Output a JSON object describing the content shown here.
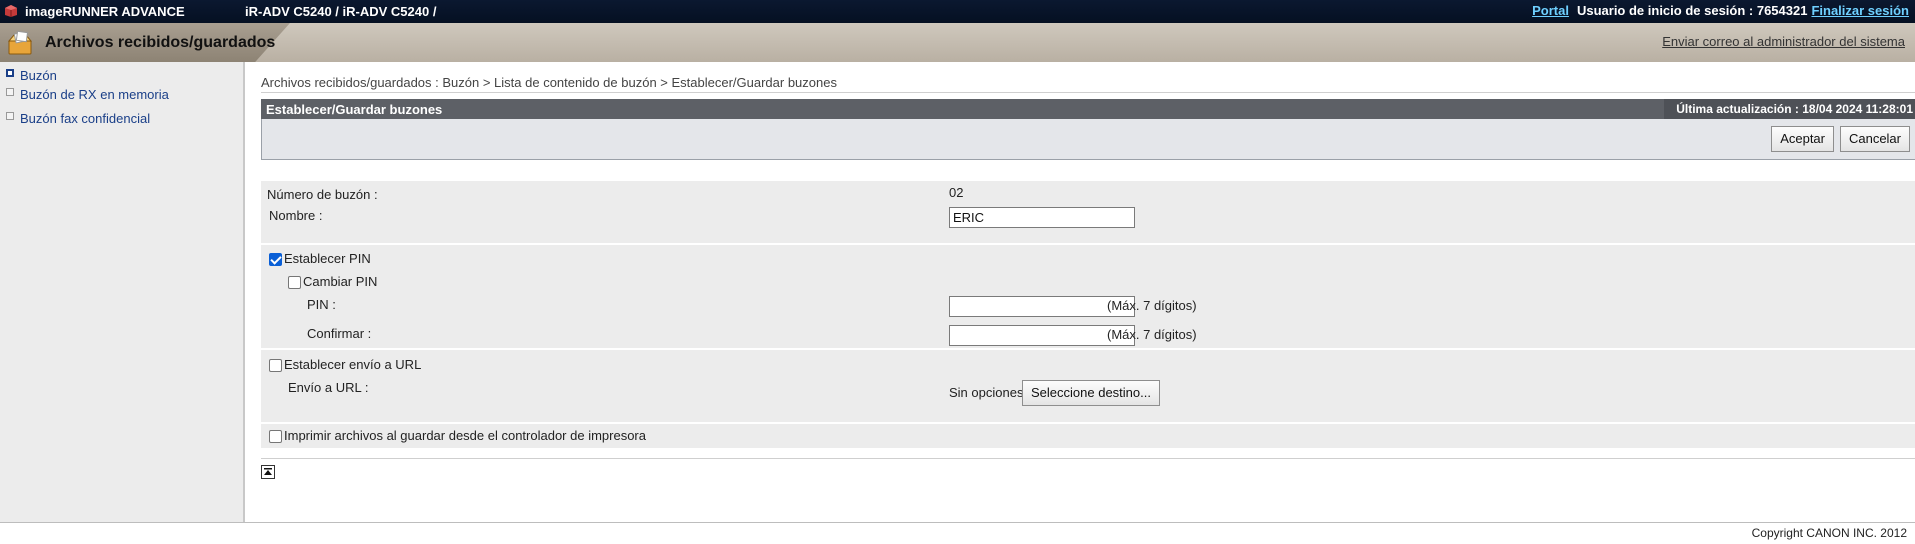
{
  "topbar": {
    "product": "imageRUNNER ADVANCE",
    "device": "iR-ADV C5240 / iR-ADV C5240 /",
    "portal_link": "Portal",
    "login_user": "Usuario de inicio de sesión : 7654321",
    "logout_link": "Finalizar sesión"
  },
  "header": {
    "title": "Archivos recibidos/guardados",
    "mail_admin": "Enviar correo al administrador del sistema"
  },
  "sidebar": {
    "items": [
      {
        "label": "Buzón",
        "active": true
      },
      {
        "label": "Buzón de RX en memoria",
        "active": false
      },
      {
        "label": "Buzón fax confidencial",
        "active": false
      }
    ]
  },
  "main": {
    "breadcrumb": "Archivos recibidos/guardados : Buzón > Lista de contenido de buzón > Establecer/Guardar buzones",
    "section_title": "Establecer/Guardar buzones",
    "last_update": "Última actualización : 18/04 2024 11:28:01",
    "ok_button": "Aceptar",
    "cancel_button": "Cancelar",
    "box_number_label": "Número de buzón :",
    "box_number_value": "02",
    "name_label": "Nombre :",
    "name_value": "ERIC",
    "set_pin_label": "Establecer PIN",
    "set_pin_checked": true,
    "change_pin_label": "Cambiar PIN",
    "change_pin_checked": false,
    "pin_label": "PIN :",
    "pin_value": "",
    "pin_note": "(Máx. 7 dígitos)",
    "confirm_label": "Confirmar :",
    "confirm_value": "",
    "confirm_note": "(Máx. 7 dígitos)",
    "url_send_label": "Establecer envío a URL",
    "url_send_checked": false,
    "url_dest_label": "Envío a URL :",
    "url_dest_value": "Sin opciones.",
    "select_dest_button": "Seleccione destino...",
    "print_on_save_label": "Imprimir archivos al guardar desde el controlador de impresora",
    "print_on_save_checked": false
  },
  "footer": {
    "copyright": "Copyright CANON INC. 2012"
  },
  "colors": {
    "topbar_bg": "#0b1830",
    "link_accent": "#6fd0ff",
    "section_header": "#5d6066",
    "panel_bg": "#ececec",
    "checkbox_checked": "#0a5fd6"
  }
}
